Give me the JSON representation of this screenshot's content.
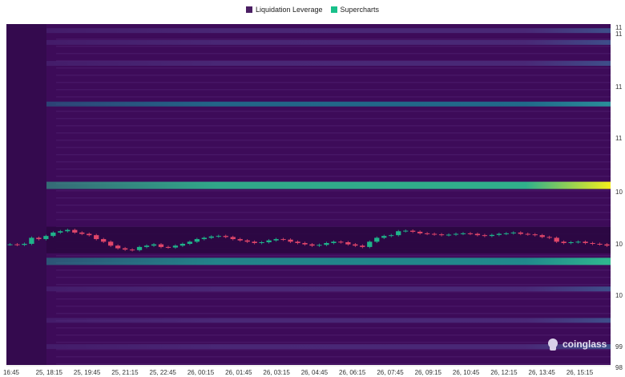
{
  "legend": [
    {
      "label": "Liquidation Leverage",
      "color": "#4b1f63"
    },
    {
      "label": "Supercharts",
      "color": "#19c08a"
    }
  ],
  "watermark": {
    "text": "coinglass"
  },
  "colors": {
    "background": "#3d0b59",
    "up": "#1fb38a",
    "down": "#e0466a",
    "hot": "#f5ee1c"
  },
  "chart_data": {
    "type": "heatmap",
    "x_tick_labels": [
      "16:45",
      "25, 18:15",
      "25, 19:45",
      "25, 21:15",
      "25, 22:45",
      "26, 00:15",
      "26, 01:45",
      "26, 03:15",
      "26, 04:45",
      "26, 06:15",
      "26, 07:45",
      "26, 09:15",
      "26, 10:45",
      "26, 12:15",
      "26, 13:45",
      "26, 15:15"
    ],
    "y_tick_labels": [
      "11",
      "11",
      "11",
      "11",
      "10",
      "10",
      "10",
      "99",
      "98"
    ],
    "ylim": [
      97.5,
      110.5
    ],
    "liquidation_bands": [
      {
        "price": 110.25,
        "intensity": 0.25
      },
      {
        "price": 109.8,
        "intensity": 0.2
      },
      {
        "price": 109.0,
        "intensity": 0.3
      },
      {
        "price": 107.45,
        "intensity": 0.55
      },
      {
        "price": 104.35,
        "intensity": 1.0
      },
      {
        "price": 101.45,
        "intensity": 0.8
      },
      {
        "price": 100.4,
        "intensity": 0.3
      },
      {
        "price": 99.2,
        "intensity": 0.3
      },
      {
        "price": 98.2,
        "intensity": 0.2
      }
    ],
    "price_series": [
      102.1,
      102.08,
      102.12,
      102.35,
      102.3,
      102.42,
      102.55,
      102.6,
      102.65,
      102.55,
      102.5,
      102.45,
      102.3,
      102.2,
      102.05,
      101.95,
      101.9,
      101.88,
      102.0,
      102.05,
      102.1,
      102.0,
      101.98,
      102.05,
      102.12,
      102.2,
      102.3,
      102.35,
      102.4,
      102.42,
      102.38,
      102.3,
      102.25,
      102.2,
      102.15,
      102.18,
      102.25,
      102.3,
      102.28,
      102.2,
      102.15,
      102.1,
      102.05,
      102.08,
      102.15,
      102.2,
      102.18,
      102.1,
      102.05,
      102.0,
      102.2,
      102.35,
      102.42,
      102.45,
      102.6,
      102.62,
      102.58,
      102.52,
      102.5,
      102.48,
      102.45,
      102.47,
      102.5,
      102.52,
      102.5,
      102.45,
      102.42,
      102.46,
      102.5,
      102.52,
      102.55,
      102.5,
      102.48,
      102.45,
      102.38,
      102.35,
      102.2,
      102.15,
      102.18,
      102.2,
      102.15,
      102.12,
      102.1,
      102.05
    ]
  }
}
